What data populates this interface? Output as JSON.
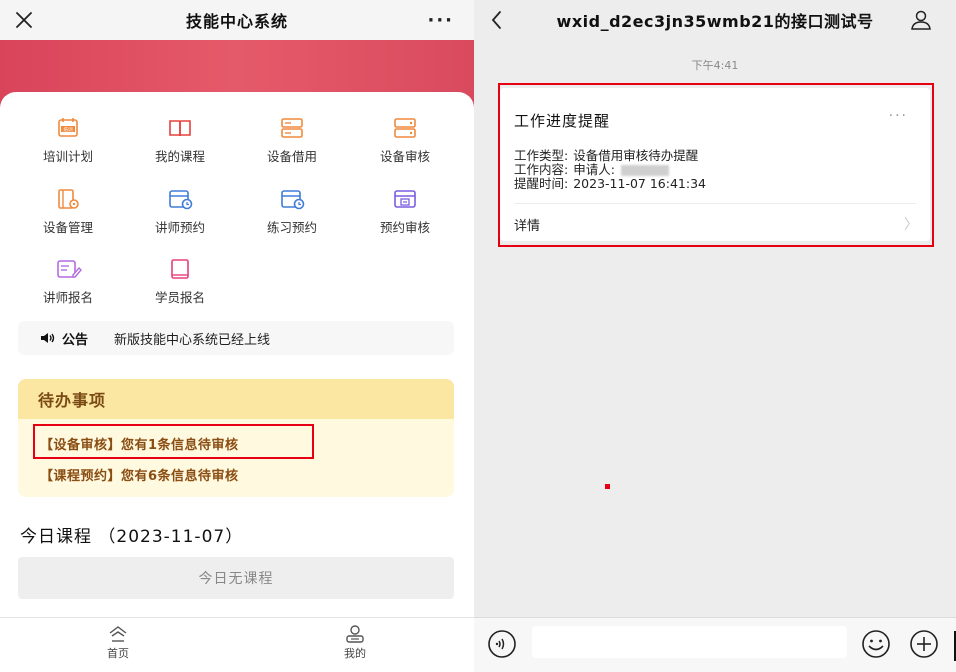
{
  "left": {
    "title": "技能中心系统",
    "more": "···",
    "grid": [
      {
        "label": "培训计划",
        "icon": "training-plan-icon",
        "color": "#f08a3c"
      },
      {
        "label": "我的课程",
        "icon": "book-icon",
        "color": "#e5403c"
      },
      {
        "label": "设备借用",
        "icon": "device-borrow-icon",
        "color": "#f08a3c"
      },
      {
        "label": "设备审核",
        "icon": "device-review-icon",
        "color": "#f08a3c"
      },
      {
        "label": "设备管理",
        "icon": "device-manage-icon",
        "color": "#f08a3c"
      },
      {
        "label": "讲师预约",
        "icon": "lecturer-booking-icon",
        "color": "#3e7dd8"
      },
      {
        "label": "练习预约",
        "icon": "practice-booking-icon",
        "color": "#3e7dd8"
      },
      {
        "label": "预约审核",
        "icon": "booking-review-icon",
        "color": "#7a5de0"
      },
      {
        "label": "讲师报名",
        "icon": "lecturer-signup-icon",
        "color": "#b36de0"
      },
      {
        "label": "学员报名",
        "icon": "student-signup-icon",
        "color": "#e5407a"
      }
    ],
    "training_badge": "培训",
    "notice": {
      "label": "公告",
      "text": "新版技能中心系统已经上线"
    },
    "todo": {
      "title": "待办事项",
      "items": [
        "【设备审核】您有1条信息待审核",
        "【课程预约】您有6条信息待审核"
      ]
    },
    "today": {
      "title": "今日课程 （2023-11-07）",
      "empty": "今日无课程"
    },
    "tabs": [
      {
        "label": "首页"
      },
      {
        "label": "我的"
      }
    ]
  },
  "right": {
    "title": "wxid_d2ec3jn35wmb21的接口测试号",
    "time": "下午4:41",
    "message": {
      "title": "工作进度提醒",
      "more": "···",
      "work_type_key": "工作类型:",
      "work_type_val": "设备借用审核待办提醒",
      "work_content_key": "工作内容:",
      "work_content_val": "申请人:",
      "remind_time_key": "提醒时间:",
      "remind_time_val": "2023-11-07 16:41:34",
      "detail": "详情",
      "chevron": "〉"
    }
  },
  "colors": {
    "banner": "#dc4a5c",
    "highlight": "#e60012",
    "todo_bg": "#fff9e0",
    "todo_head": "#fbe6a2"
  }
}
